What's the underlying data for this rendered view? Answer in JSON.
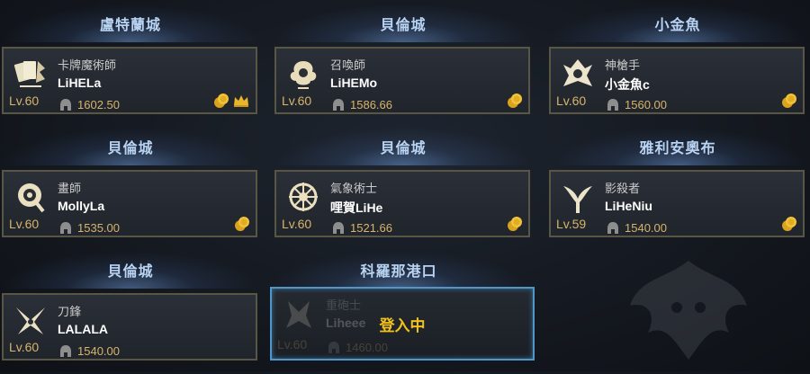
{
  "characters": [
    {
      "server": "盧特蘭城",
      "class": "卡牌魔術師",
      "name": "LiHELa",
      "level": "Lv.60",
      "item_level": "1602.50",
      "emblem": "card-master-emblem-icon",
      "badges": [
        "coin-icon",
        "crown-icon"
      ]
    },
    {
      "server": "貝倫城",
      "class": "召喚師",
      "name": "LiHEMo",
      "level": "Lv.60",
      "item_level": "1586.66",
      "emblem": "summoner-emblem-icon",
      "badges": [
        "coin-icon"
      ]
    },
    {
      "server": "小金魚",
      "class": "神槍手",
      "name": "小金魚c",
      "level": "Lv.60",
      "item_level": "1560.00",
      "emblem": "sharpshooter-emblem-icon",
      "badges": [
        "coin-icon"
      ]
    },
    {
      "server": "貝倫城",
      "class": "畫師",
      "name": "MollyLa",
      "level": "Lv.60",
      "item_level": "1535.00",
      "emblem": "artist-emblem-icon",
      "badges": [
        "coin-icon"
      ]
    },
    {
      "server": "貝倫城",
      "class": "氣象術士",
      "name": "哩賀LiHe",
      "level": "Lv.60",
      "item_level": "1521.66",
      "emblem": "aeromancer-emblem-icon",
      "badges": [
        "coin-icon"
      ]
    },
    {
      "server": "雅利安奧布",
      "class": "影殺者",
      "name": "LiHeNiu",
      "level": "Lv.59",
      "item_level": "1540.00",
      "emblem": "shadowhunter-emblem-icon",
      "badges": [
        "coin-icon"
      ]
    },
    {
      "server": "貝倫城",
      "class": "刀鋒",
      "name": "LALALA",
      "level": "Lv.60",
      "item_level": "1540.00",
      "emblem": "blade-emblem-icon",
      "badges": []
    }
  ],
  "loading_slot": {
    "server": "科羅那港口",
    "class": "重砲士",
    "name": "Liheee",
    "level": "Lv.60",
    "item_level": "1460.00",
    "status": "登入中"
  }
}
